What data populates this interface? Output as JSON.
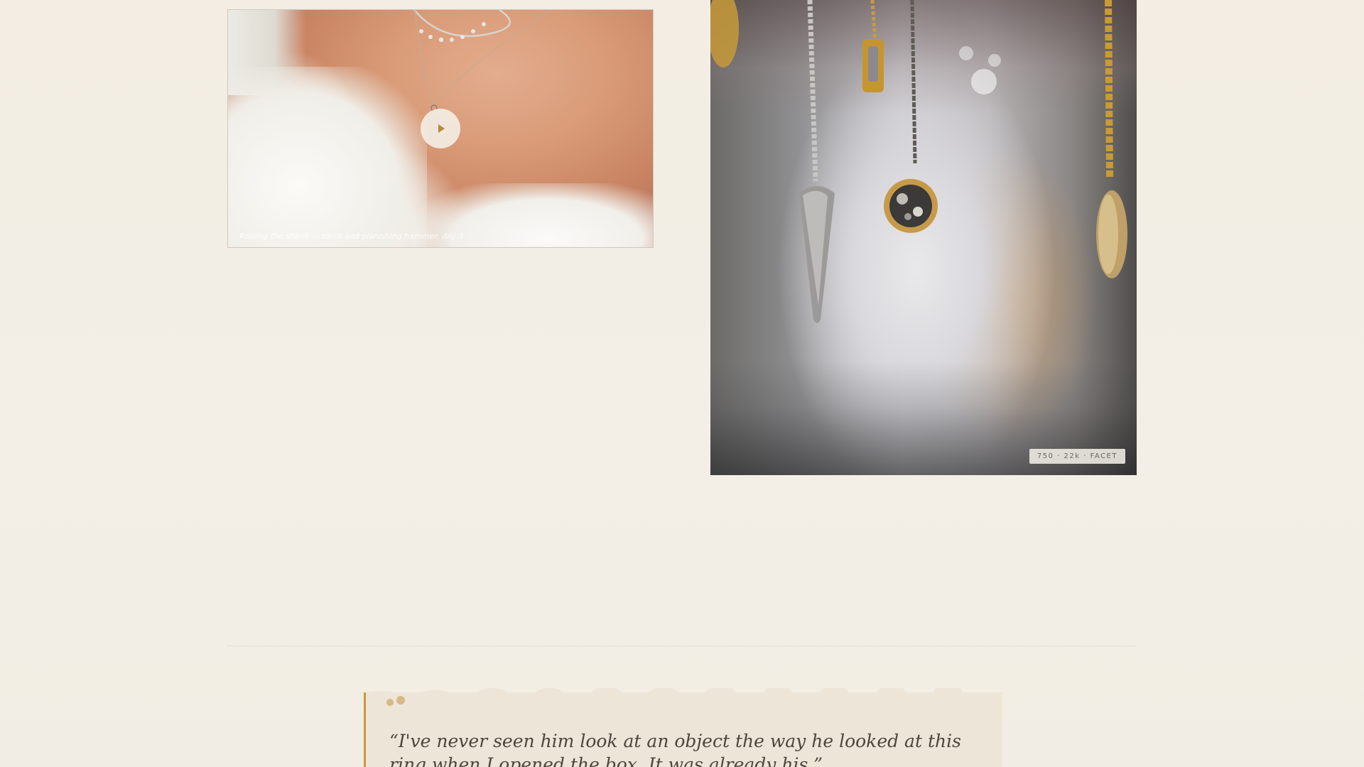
{
  "video": {
    "caption": "Raising the shank — torch and planishing hammer, day 3",
    "play_icon": "play-icon"
  },
  "photo": {
    "badge": "750 · 22k · FACET"
  },
  "testimonial": {
    "quote": "“I've never seen him look at an object the way he looked at this ring when I opened the box. It was already his.”",
    "quote_icon": "quote-mark-icon",
    "accent_color": "#c9973f"
  }
}
